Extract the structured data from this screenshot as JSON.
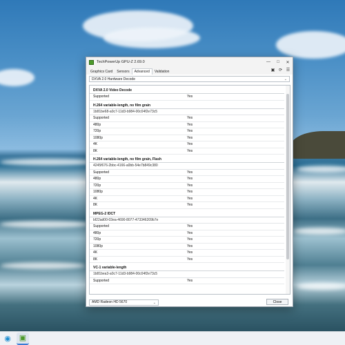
{
  "window": {
    "title": "TechPowerUp GPU-Z 2.69.0",
    "min_glyph": "—",
    "max_glyph": "□",
    "close_glyph": "✕"
  },
  "tabs": [
    {
      "label": "Graphics Card"
    },
    {
      "label": "Sensors"
    },
    {
      "label": "Advanced",
      "active": true
    },
    {
      "label": "Validation"
    }
  ],
  "toolbar_icons": {
    "camera": "▣",
    "refresh": "⟳",
    "menu": "☰"
  },
  "section_dropdown": {
    "value": "DXVA 2.0 Hardware Decode",
    "caret": "⌄"
  },
  "sections": [
    {
      "title": "DXVA 2.0 Video Decode",
      "guid": "",
      "rows": [
        {
          "k": "Supported",
          "v": "Yes"
        }
      ]
    },
    {
      "title": "H.264 variable-length, no film grain",
      "guid": "1b81be68-a0c7-11d3-b984-00c04f2e73c5",
      "rows": [
        {
          "k": "Supported",
          "v": "Yes"
        },
        {
          "k": "480p",
          "v": "Yes"
        },
        {
          "k": "720p",
          "v": "Yes"
        },
        {
          "k": "1080p",
          "v": "Yes"
        },
        {
          "k": "4K",
          "v": "Yes"
        },
        {
          "k": "8K",
          "v": "Yes"
        }
      ]
    },
    {
      "title": "H.264 variable-length, no film grain, Flash",
      "guid": "4245f676-2bbc-4166-a0bb-54e7b849c380",
      "rows": [
        {
          "k": "Supported",
          "v": "Yes"
        },
        {
          "k": "480p",
          "v": "Yes"
        },
        {
          "k": "720p",
          "v": "Yes"
        },
        {
          "k": "1080p",
          "v": "Yes"
        },
        {
          "k": "4K",
          "v": "Yes"
        },
        {
          "k": "8K",
          "v": "Yes"
        }
      ]
    },
    {
      "title": "MPEG-2 IDCT",
      "guid": "bf22ad00-03ea-4690-8077-473346209b7e",
      "rows": [
        {
          "k": "Supported",
          "v": "Yes"
        },
        {
          "k": "480p",
          "v": "Yes"
        },
        {
          "k": "720p",
          "v": "Yes"
        },
        {
          "k": "1080p",
          "v": "Yes"
        },
        {
          "k": "4K",
          "v": "Yes"
        },
        {
          "k": "8K",
          "v": "Yes"
        }
      ]
    },
    {
      "title": "VC-1 variable-length",
      "guid": "1b81bea3-a0c7-11d3-b984-00c04f2e73c5",
      "rows": [
        {
          "k": "Supported",
          "v": "Yes"
        }
      ]
    }
  ],
  "gpu_select": {
    "value": "AMD Radeon HD 5670",
    "caret": "⌄"
  },
  "close_button": "Close",
  "taskbar": {
    "edge_icon": "◉",
    "gpuz_icon": "▣"
  },
  "colors": {
    "accent": "#3a7bd5",
    "gpuz_green": "#4c9a2a"
  }
}
